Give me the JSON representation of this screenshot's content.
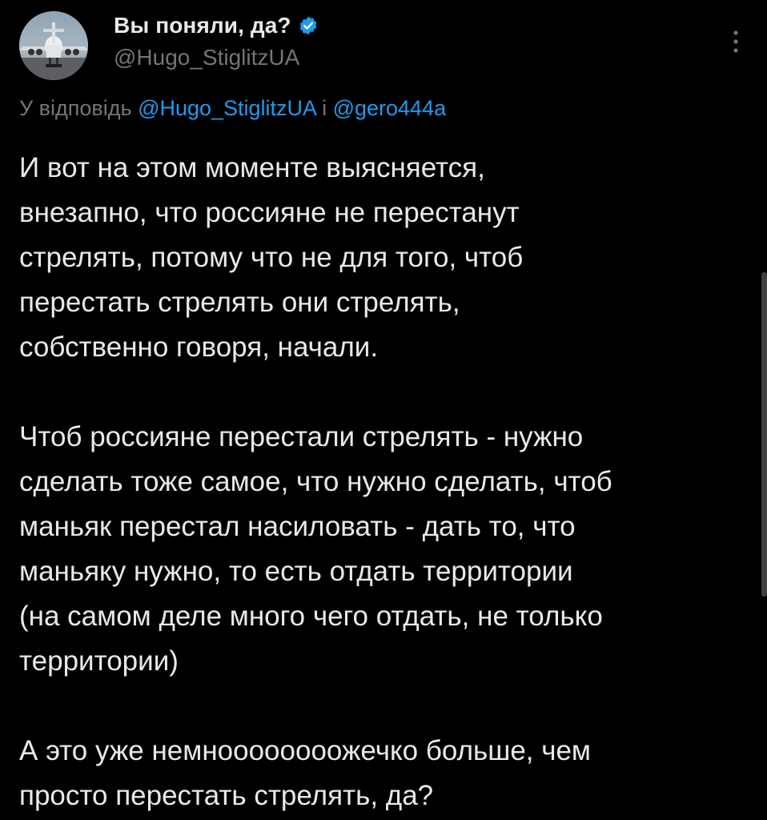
{
  "tweet": {
    "display_name": "Вы поняли, да?",
    "handle": "@Hugo_StiglitzUA",
    "verified_icon": "verified-badge-icon",
    "more_icon": "more-vertical-icon",
    "reply_prefix": "У відповідь ",
    "reply_mention_1": "@Hugo_StiglitzUA",
    "reply_joiner": " і ",
    "reply_mention_2": "@gero444a",
    "body": "И вот на этом моменте выясняется,\nвнезапно, что россияне не перестанут\nстрелять, потому что не для того, чтоб\nперестать стрелять они стрелять,\nсобственно говоря, начали.\n\nЧтоб россияне перестали стрелять - нужно\nсделать тоже самое, что нужно сделать, чтоб\nманьяк перестал насиловать - дать то, что\nманьяку нужно, то есть отдать территории\n(на самом деле много чего отдать, не только\nтерритории)\n\nА это уже немноооооооожечко больше, чем\nпросто перестать стрелять, да?"
  },
  "colors": {
    "background": "#000000",
    "text": "#e7e9ea",
    "secondary": "#71767b",
    "accent": "#1d9bf0"
  }
}
